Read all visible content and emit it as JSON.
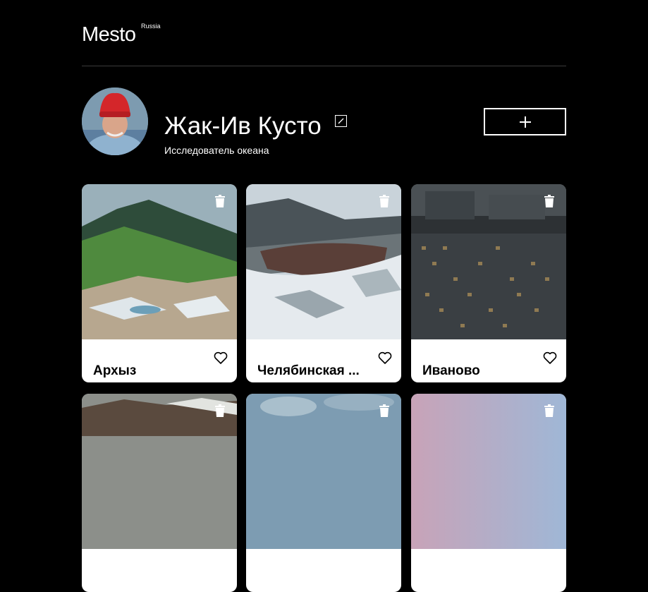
{
  "header": {
    "logo": "Mesto",
    "logo_sup": "Russia"
  },
  "profile": {
    "name": "Жак-Ив Кусто",
    "about": "Исследователь океана",
    "avatar_alt": "avatar-photo",
    "edit_icon": "pencil-icon",
    "add_icon": "plus-icon"
  },
  "cards": [
    {
      "title": "Архыз",
      "image": "mountain-valley"
    },
    {
      "title": "Челябинская ...",
      "image": "snowy-river"
    },
    {
      "title": "Иваново",
      "image": "apartment-block"
    },
    {
      "title": "",
      "image": "mountain-snow"
    },
    {
      "title": "",
      "image": "cloudy-sky"
    },
    {
      "title": "",
      "image": "pink-sky"
    }
  ],
  "colors": {
    "background": "#000000",
    "card": "#ffffff",
    "divider": "#545454"
  }
}
